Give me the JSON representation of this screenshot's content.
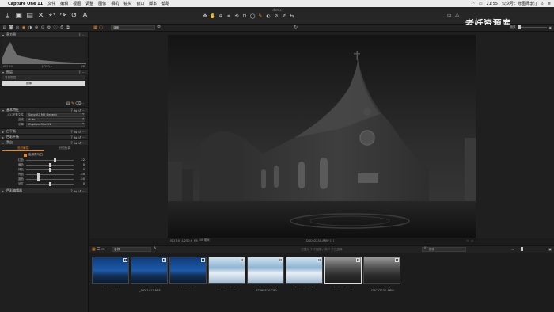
{
  "menubar": {
    "apple": "",
    "app": "Capture One 11",
    "items": [
      "文件",
      "编辑",
      "视图",
      "调整",
      "图像",
      "相机",
      "镜头",
      "窗口",
      "脚本",
      "帮助"
    ],
    "time": "21:55",
    "user": "公众号：修图师李汀"
  },
  "toolbar": {
    "doc_title": "demo",
    "watermark": "老妖资源库"
  },
  "left_panel": {
    "histogram": {
      "title": "直方图",
      "iso": "ISO 50",
      "shutter": "1/250 s",
      "aperture": "f/8"
    },
    "layers": {
      "title": "图层",
      "background": "背景图层",
      "selected": "图像"
    },
    "basic": {
      "title": "基本特征",
      "icc_label": "ICC配置文件",
      "icc_value": "Sony A7 M2 Generic",
      "curve_label": "曲线",
      "curve_value": "Auto",
      "engine_label": "引擎",
      "engine_value": "Capture One 11"
    },
    "white_balance": {
      "title": "白平衡"
    },
    "color_balance": {
      "title": "色彩平衡"
    },
    "bw": {
      "title": "黑白",
      "tab_active": "色彩敏感",
      "tab_other": "分割色调",
      "enable_label": "启用黑与白",
      "sliders": [
        {
          "label": "红色",
          "value": "22",
          "pos": 0.61
        },
        {
          "label": "黄色",
          "value": "0",
          "pos": 0.5
        },
        {
          "label": "绿色",
          "value": "0",
          "pos": 0.5
        },
        {
          "label": "青色",
          "value": "-50",
          "pos": 0.25
        },
        {
          "label": "蓝色",
          "value": "-50",
          "pos": 0.25
        },
        {
          "label": "品红",
          "value": "0",
          "pos": 0.5
        }
      ]
    },
    "color_editor": {
      "title": "色彩编辑器"
    }
  },
  "viewer_bar": {
    "preset": "背景",
    "label_right": "缩放"
  },
  "photo_info": {
    "iso": "ISO 50",
    "shutter": "1/250 s",
    "aperture": "f/8",
    "focal": "16 毫米",
    "filename": "DSC02231.ARW [1]"
  },
  "film_bar": {
    "sort": "名称",
    "status": "已显示 7 个图像，共 7 个已选择",
    "search": "搜索"
  },
  "filmstrip": {
    "thumbs": [
      {
        "badge": "1",
        "style": "sky1"
      },
      {
        "badge": "1",
        "style": "sky1"
      },
      {
        "badge": "1",
        "style": "sky1"
      },
      {
        "badge": "1",
        "style": "sky2"
      },
      {
        "badge": "1",
        "style": "sky2"
      },
      {
        "badge": "1",
        "style": "sky2"
      },
      {
        "badge": "1",
        "style": "sky3"
      },
      {
        "badge": "1",
        "style": "sky3"
      }
    ],
    "labels": [
      "_DSC1411.NEF",
      "67368570.CR2",
      "DSC02231.ARW"
    ],
    "stars": "• • • • •"
  }
}
